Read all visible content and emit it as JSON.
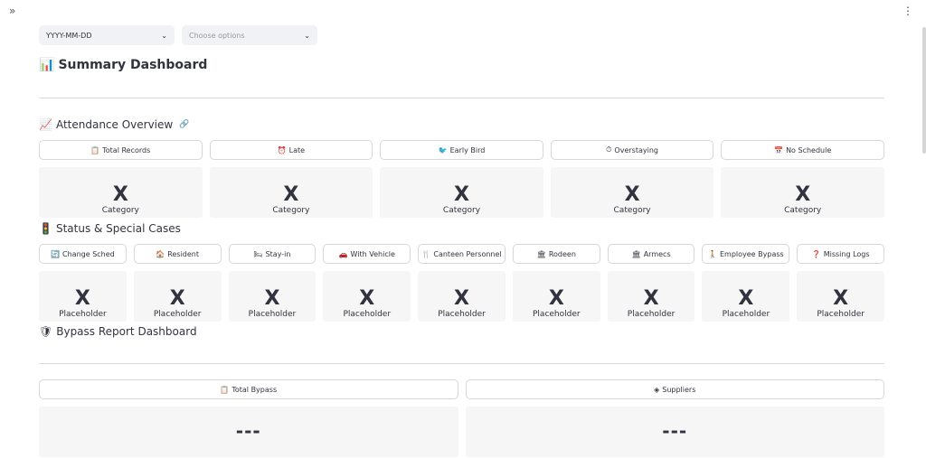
{
  "toolbar": {
    "sidebar_toggle": "»",
    "menu_icon": "⋮"
  },
  "filters": {
    "date": {
      "value": "YYYY-MM-DD",
      "chevron": "⌄"
    },
    "options": {
      "placeholder": "Choose options",
      "chevron": "⌄"
    }
  },
  "summary": {
    "icon": "📊",
    "title": "Summary Dashboard"
  },
  "attendance": {
    "icon": "📈",
    "title": "Attendance Overview",
    "link_icon": "🔗",
    "buttons": [
      {
        "icon": "📋",
        "label": "Total Records"
      },
      {
        "icon": "⏰",
        "label": "Late"
      },
      {
        "icon": "🐦",
        "label": "Early Bird"
      },
      {
        "icon": "⏱",
        "label": "Overstaying"
      },
      {
        "icon": "📅",
        "label": "No Schedule"
      }
    ],
    "cards": [
      {
        "value": "X",
        "label": "Category"
      },
      {
        "value": "X",
        "label": "Category"
      },
      {
        "value": "X",
        "label": "Category"
      },
      {
        "value": "X",
        "label": "Category"
      },
      {
        "value": "X",
        "label": "Category"
      }
    ]
  },
  "status": {
    "icon": "🚦",
    "title": "Status & Special Cases",
    "buttons": [
      {
        "icon": "🔄",
        "label": "Change Sched"
      },
      {
        "icon": "🏠",
        "label": "Resident"
      },
      {
        "icon": "🛏",
        "label": "Stay-in"
      },
      {
        "icon": "🚗",
        "label": "With Vehicle"
      },
      {
        "icon": "🍴",
        "label": "Canteen Personnel"
      },
      {
        "icon": "🏛",
        "label": "Rodeen"
      },
      {
        "icon": "🏛",
        "label": "Armecs"
      },
      {
        "icon": "🚶",
        "label": "Employee Bypass"
      },
      {
        "icon": "❓",
        "label": "Missing Logs"
      }
    ],
    "cards": [
      {
        "value": "X",
        "label": "Placeholder"
      },
      {
        "value": "X",
        "label": "Placeholder"
      },
      {
        "value": "X",
        "label": "Placeholder"
      },
      {
        "value": "X",
        "label": "Placeholder"
      },
      {
        "value": "X",
        "label": "Placeholder"
      },
      {
        "value": "X",
        "label": "Placeholder"
      },
      {
        "value": "X",
        "label": "Placeholder"
      },
      {
        "value": "X",
        "label": "Placeholder"
      },
      {
        "value": "X",
        "label": "Placeholder"
      }
    ]
  },
  "bypass": {
    "icon": "🛡",
    "title": "Bypass Report Dashboard",
    "buttons": [
      {
        "icon": "📋",
        "label": "Total Bypass"
      },
      {
        "icon": "◈",
        "label": "Suppliers"
      }
    ],
    "cards": [
      {
        "value": "---"
      },
      {
        "value": "---"
      }
    ]
  }
}
